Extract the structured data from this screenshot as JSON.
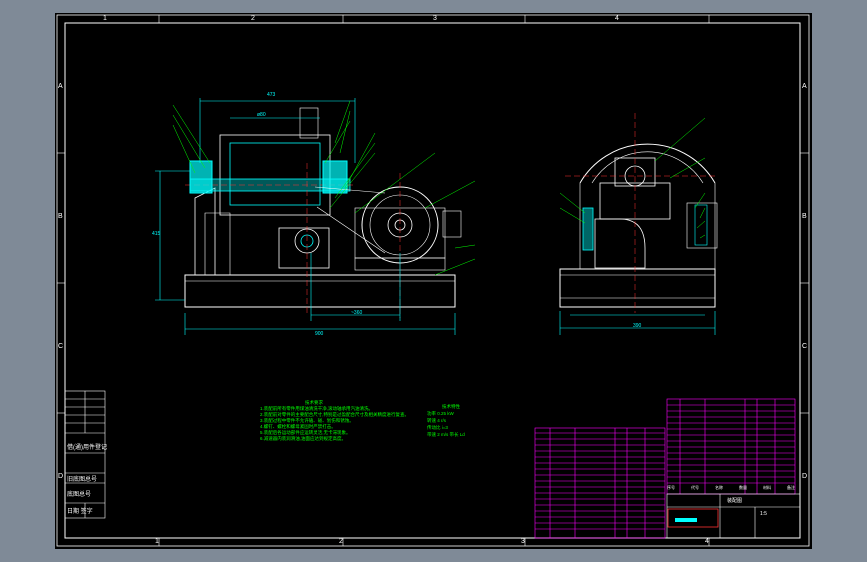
{
  "colors": {
    "background": "#7f8a97",
    "sheet": "#000000",
    "frame": "#ffffff",
    "part": "#00ff00",
    "dimension": "#00ffff",
    "table": "#ff00ff",
    "accent": "#ff3333"
  },
  "zone_labels": {
    "top": [
      "1",
      "2",
      "3",
      "4"
    ],
    "bottom": [
      "1",
      "2",
      "3",
      "4"
    ],
    "left": [
      "A",
      "B",
      "C",
      "D"
    ],
    "right": [
      "A",
      "B",
      "C",
      "D"
    ]
  },
  "side_table": {
    "rows": [
      "借(通)用件登记",
      "",
      "",
      "旧底图总号",
      "底图总号",
      "日期 签字"
    ]
  },
  "dimensions": {
    "top_span": "473",
    "bore": "ø80",
    "height": "415",
    "base_length": "900",
    "pulley_center": "~360",
    "front_base": "390"
  },
  "technical_requirements": {
    "title": "技术要求",
    "lines": [
      "1.装配前所有零件用煤油清洗干净,滚动轴承用汽油清洗。",
      "2.装配前对零件的主要配合尺寸,特别是过盈配合尺寸及相关精度进行复查。",
      "3.装配过程中零件不允许磕、碰、划伤和锈蚀。",
      "4.螺钉、螺栓和螺母紧固时严禁打击。",
      "5.装配后各运动部件应运转灵活,无卡滞现象。",
      "6.减速器内装润滑油,油面应达到规定高度。"
    ]
  },
  "technical_specs": {
    "title": "技术特性",
    "lines": [
      "功率 0.25 kW",
      "转速 4 r/s",
      "传动比 i=3",
      "带速 2 m/s 带长 Ld"
    ]
  },
  "title_block": {
    "header": [
      "序号",
      "代号",
      "名称",
      "数量",
      "材料",
      "备注"
    ],
    "drawing_title": "装配图",
    "scale": "1:5"
  }
}
